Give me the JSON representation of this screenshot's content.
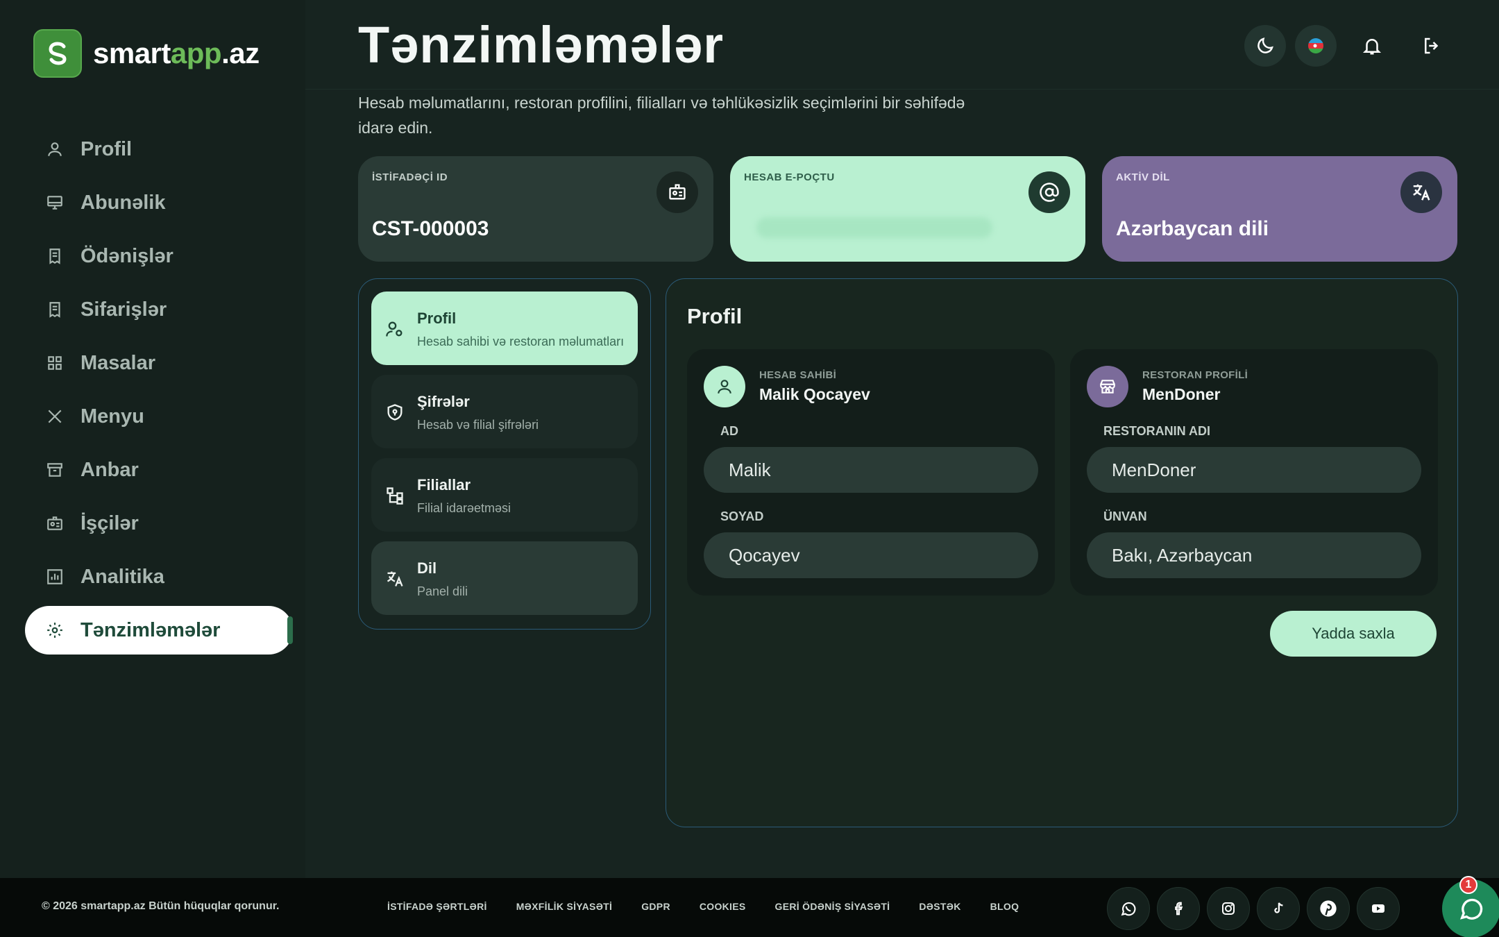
{
  "brand": {
    "name_main": "smart",
    "name_accent": "app",
    "name_tld": ".az"
  },
  "sidebar": {
    "items": [
      {
        "label": "Profil",
        "icon": "user-icon"
      },
      {
        "label": "Abunəlik",
        "icon": "monitor-icon"
      },
      {
        "label": "Ödənişlər",
        "icon": "receipt-icon"
      },
      {
        "label": "Sifarişlər",
        "icon": "receipt-icon"
      },
      {
        "label": "Masalar",
        "icon": "grid-icon"
      },
      {
        "label": "Menyu",
        "icon": "utensils-icon"
      },
      {
        "label": "Anbar",
        "icon": "archive-icon"
      },
      {
        "label": "İşçilər",
        "icon": "id-card-icon"
      },
      {
        "label": "Analitika",
        "icon": "chart-icon"
      },
      {
        "label": "Tənzimləmələr",
        "icon": "gear-icon",
        "active": true
      }
    ]
  },
  "header": {
    "title": "Tənzimləmələr",
    "subtitle": "Hesab məlumatlarını, restoran profilini, filialları və təhlükəsizlik seçimlərini bir səhifədə idarə edin."
  },
  "stats": {
    "user_id": {
      "label": "İSTİFADƏÇİ ID",
      "value": "CST-000003"
    },
    "email": {
      "label": "HESAB E-POÇTU",
      "value": ""
    },
    "language": {
      "label": "AKTİV DİL",
      "value": "Azərbaycan dili"
    }
  },
  "settings_nav": [
    {
      "title": "Profil",
      "sub": "Hesab sahibi və restoran məlumatları"
    },
    {
      "title": "Şifrələr",
      "sub": "Hesab və filial şifrələri"
    },
    {
      "title": "Filiallar",
      "sub": "Filial idarəetməsi"
    },
    {
      "title": "Dil",
      "sub": "Panel dili"
    }
  ],
  "panel": {
    "title": "Profil",
    "owner": {
      "kicker": "HESAB SAHİBİ",
      "name": "Malik Qocayev",
      "first_label": "AD",
      "first_value": "Malik",
      "last_label": "SOYAD",
      "last_value": "Qocayev"
    },
    "restaurant": {
      "kicker": "RESTORAN PROFİLİ",
      "name": "MenDoner",
      "name_label": "RESTORANIN ADI",
      "name_value": "MenDoner",
      "address_label": "ÜNVAN",
      "address_value": "Bakı, Azərbaycan"
    },
    "save_label": "Yadda saxla"
  },
  "footer": {
    "copyright": "© 2026 smartapp.az Bütün hüquqlar qorunur.",
    "links": [
      "İSTİFADƏ ŞƏRTLƏRİ",
      "MƏXFİLİK SİYASƏTİ",
      "GDPR",
      "COOKIES",
      "GERİ ÖDƏNİŞ SİYASƏTİ",
      "DƏSTƏK",
      "BLOQ"
    ],
    "chat_badge": "1"
  },
  "colors": {
    "accent_green": "#b9f0d1",
    "accent_purple": "#7b6b9a",
    "card_dark": "#2a3b36",
    "border_blue": "#2b5b78"
  }
}
